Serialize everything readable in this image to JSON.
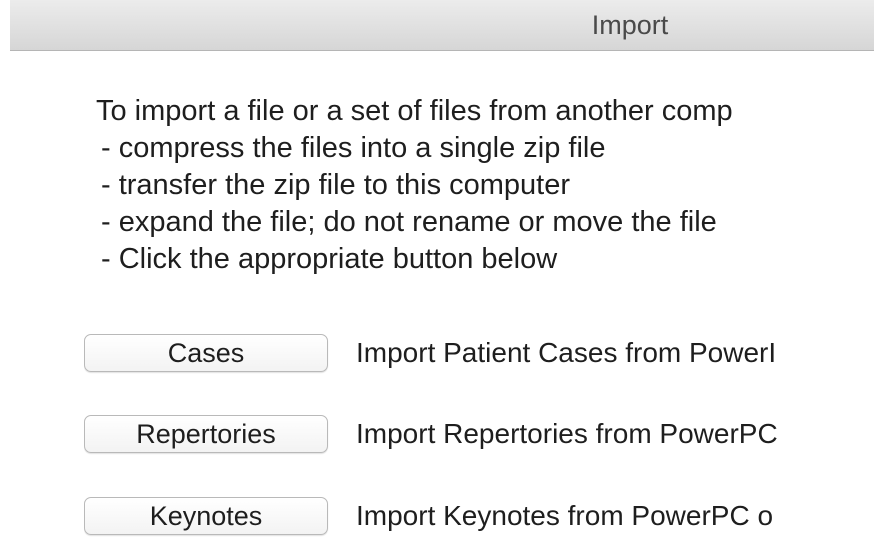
{
  "window": {
    "title": "Import"
  },
  "instructions": {
    "intro": "To import a file or a set of files from another comp",
    "steps": [
      "- compress the files into a single zip file",
      "- transfer the zip file to this computer",
      "- expand the file; do not rename or move the file",
      "- Click the appropriate button below"
    ]
  },
  "import_options": [
    {
      "button_label": "Cases",
      "description": "Import Patient Cases from PowerI"
    },
    {
      "button_label": "Repertories",
      "description": "Import Repertories from PowerPC"
    },
    {
      "button_label": "Keynotes",
      "description": "Import Keynotes from PowerPC o"
    }
  ]
}
